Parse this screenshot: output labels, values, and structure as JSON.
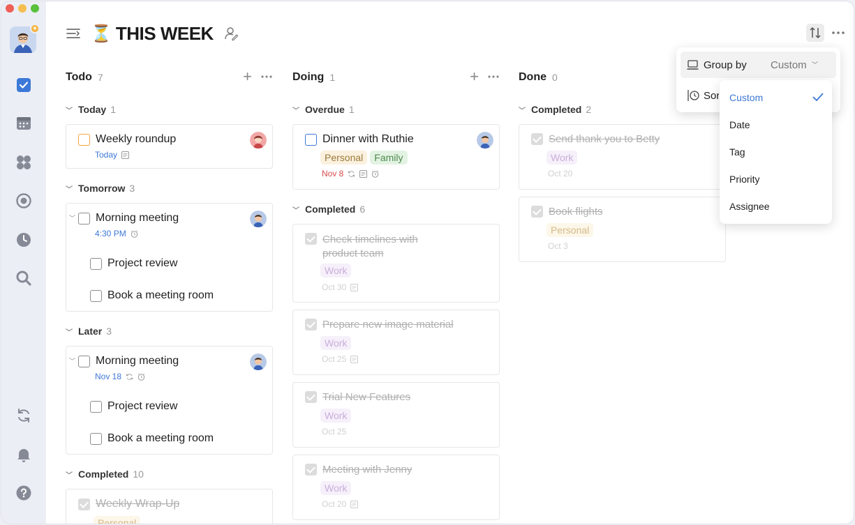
{
  "window_controls": {
    "close": "#ee5f57",
    "minimize": "#f5be4f",
    "maximize": "#59c13c"
  },
  "colors": {
    "accent": "#3d78d8",
    "overdue": "#d94a4a",
    "priority": "#f5a33c"
  },
  "sidebar": {
    "items": [
      {
        "icon": "checkbox-icon",
        "active": true
      },
      {
        "icon": "calendar-icon"
      },
      {
        "icon": "grid-icon"
      },
      {
        "icon": "focus-icon"
      },
      {
        "icon": "clock-icon"
      },
      {
        "icon": "search-icon"
      }
    ],
    "bottom_items": [
      {
        "icon": "sync-icon"
      },
      {
        "icon": "bell-icon"
      },
      {
        "icon": "help-icon"
      }
    ]
  },
  "header": {
    "emoji": "⏳",
    "title": "THIS WEEK"
  },
  "columns": [
    {
      "title": "Todo",
      "count": "7",
      "groups": [
        {
          "title": "Today",
          "count": "1"
        },
        {
          "title": "Tomorrow",
          "count": "3"
        },
        {
          "title": "Later",
          "count": "3"
        },
        {
          "title": "Completed",
          "count": "10"
        }
      ]
    },
    {
      "title": "Doing",
      "count": "1",
      "groups": [
        {
          "title": "Overdue",
          "count": "1"
        },
        {
          "title": "Completed",
          "count": "6"
        }
      ]
    },
    {
      "title": "Done",
      "count": "0",
      "groups": [
        {
          "title": "Completed",
          "count": "2"
        }
      ]
    }
  ],
  "tasks": {
    "weekly_roundup": {
      "title": "Weekly roundup",
      "date": "Today"
    },
    "morning_meeting_1": {
      "title": "Morning meeting",
      "time": "4:30 PM"
    },
    "project_review_1": {
      "title": "Project review"
    },
    "book_room_1": {
      "title": "Book a meeting room"
    },
    "morning_meeting_2": {
      "title": "Morning meeting",
      "date": "Nov 18"
    },
    "project_review_2": {
      "title": "Project review"
    },
    "book_room_2": {
      "title": "Book a meeting room"
    },
    "weekly_wrapup": {
      "title": "Weekly Wrap-Up",
      "tag": "Personal"
    },
    "dinner": {
      "title": "Dinner with Ruthie",
      "tags": [
        "Personal",
        "Family"
      ],
      "date": "Nov 8"
    },
    "check_timelines": {
      "title_line1": "Check timelines with",
      "title_line2": "product team",
      "tag": "Work",
      "date": "Oct 30"
    },
    "prepare_image": {
      "title": "Prepare new image material",
      "tag": "Work",
      "date": "Oct 25"
    },
    "trial_features": {
      "title": "Trial New Features",
      "tag": "Work",
      "date": "Oct 25"
    },
    "meeting_jenny": {
      "title": "Meeting with Jenny",
      "tag": "Work",
      "date": "Oct 20"
    },
    "thank_betty": {
      "title": "Send thank you to Betty",
      "tag": "Work",
      "date": "Oct 20"
    },
    "book_flights": {
      "title": "Book flights",
      "tag": "Personal",
      "date": "Oct 3"
    }
  },
  "group_popup": {
    "group_by_label": "Group by",
    "group_by_value": "Custom",
    "sort_label": "Sort"
  },
  "group_menu": {
    "options": [
      "Custom",
      "Date",
      "Tag",
      "Priority",
      "Assignee"
    ],
    "selected": "Custom"
  }
}
